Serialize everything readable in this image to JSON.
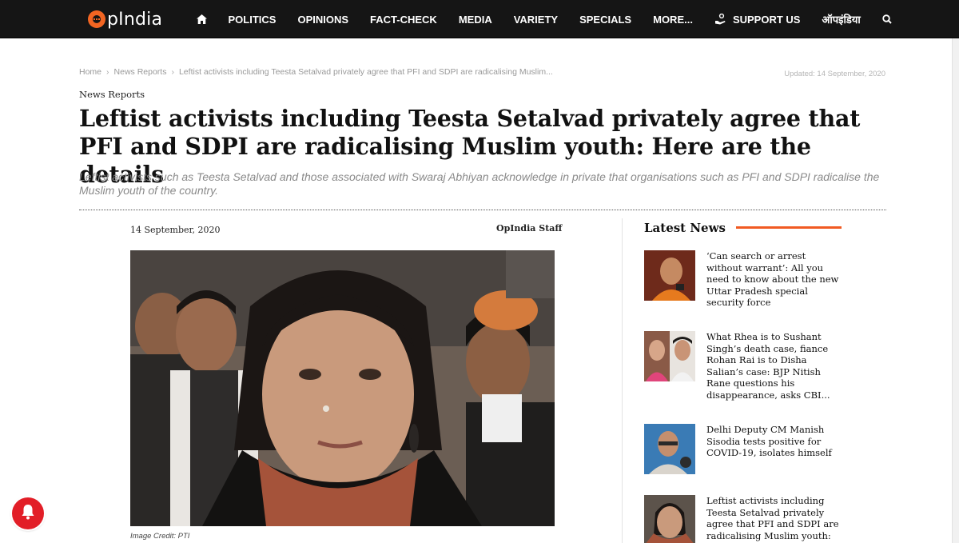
{
  "site": {
    "logo_text": "pIndia",
    "brand_color": "#f26522"
  },
  "nav": {
    "items": [
      {
        "label": "POLITICS"
      },
      {
        "label": "OPINIONS"
      },
      {
        "label": "FACT-CHECK"
      },
      {
        "label": "MEDIA"
      },
      {
        "label": "VARIETY"
      },
      {
        "label": "SPECIALS"
      },
      {
        "label": "MORE..."
      },
      {
        "label": "SUPPORT US"
      },
      {
        "label": "ऑपइंडिया"
      }
    ]
  },
  "breadcrumb": {
    "home": "Home",
    "section": "News Reports",
    "current": "Leftist activists including Teesta Setalvad privately agree that PFI and SDPI are radicalising Muslim..."
  },
  "article": {
    "updated": "Updated: 14 September, 2020",
    "category": "News Reports",
    "headline": "Leftist activists including Teesta Setalvad privately agree that PFI and SDPI are radicalising Muslim youth: Here are the details",
    "subtitle": "Leftist activists such as Teesta Setalvad and those associated with Swaraj Abhiyan acknowledge in private that organisations such as PFI and SDPI radicalise the Muslim youth of the country.",
    "date": "14 September, 2020",
    "author": "OpIndia Staff",
    "image_caption": "Image Credit: PTI"
  },
  "sidebar": {
    "title": "Latest News",
    "accent_color": "#f15a22",
    "items": [
      {
        "title": "‘Can search or arrest without warrant’: All you need to know about the new Uttar Pradesh special security force"
      },
      {
        "title": "What Rhea is to Sushant Singh’s death case, fiance Rohan Rai is to Disha Salian’s case: BJP Nitish Rane questions his disappearance, asks CBI..."
      },
      {
        "title": "Delhi Deputy CM Manish Sisodia tests positive for COVID-19, isolates himself"
      },
      {
        "title": "Leftist activists including Teesta Setalvad privately agree that PFI and SDPI are radicalising Muslim youth:"
      }
    ]
  },
  "notification": {
    "color": "#e21e27"
  }
}
